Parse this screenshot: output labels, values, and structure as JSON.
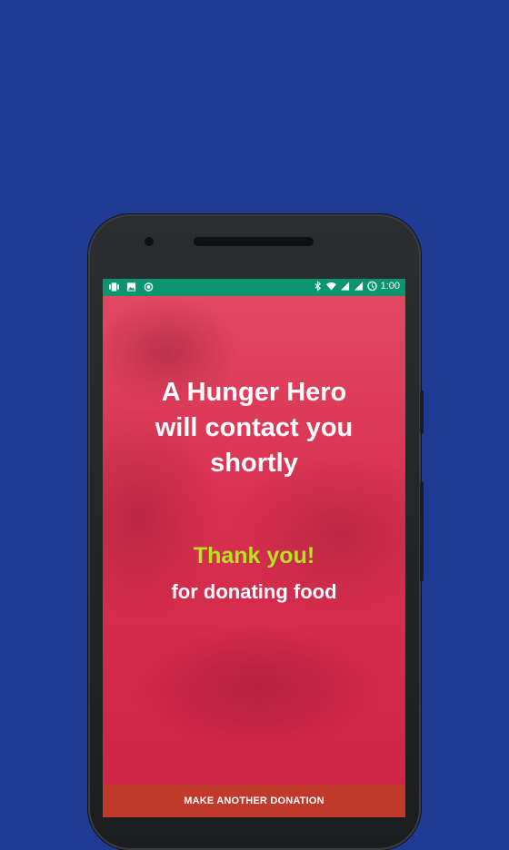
{
  "statusbar": {
    "time": "1:00",
    "left_icons": [
      "vibrate-icon",
      "image-icon",
      "record-icon"
    ],
    "right_icons": [
      "bluetooth-icon",
      "wifi-icon",
      "signal-icon",
      "signal-icon-2",
      "data-saver-icon"
    ]
  },
  "main": {
    "headline": "A Hunger Hero will contact you shortly",
    "thanks": "Thank you!",
    "subtext": "for donating food"
  },
  "cta": {
    "label": "MAKE ANOTHER DONATION"
  },
  "colors": {
    "background": "#1f3a93",
    "statusbar": "#0a9470",
    "overlay": "#d5284a",
    "accent_green": "#b5e61d",
    "button": "#c0392b"
  }
}
